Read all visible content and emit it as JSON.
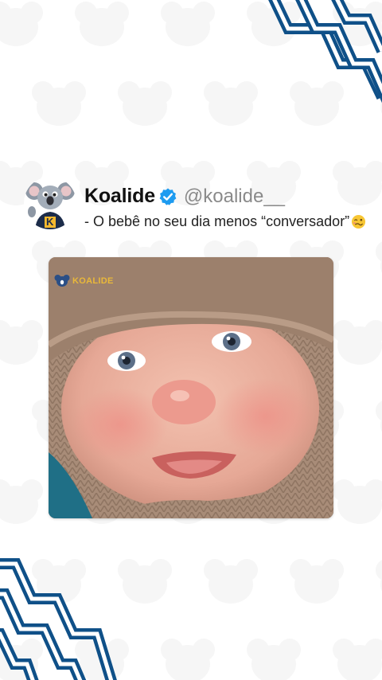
{
  "colors": {
    "accent_blue": "#0f5088",
    "verified_blue": "#1d9bf0",
    "name_text": "#111111",
    "handle_text": "#8a8a8a",
    "caption_text": "#222222",
    "watermark_gold": "#e9b83a"
  },
  "post": {
    "display_name": "Koalide",
    "handle": "@koalide__",
    "caption": "- O bebê no seu dia menos “conversador”",
    "caption_emoji_icon": "woozy-face-icon",
    "verified_icon": "verified-badge-icon"
  },
  "avatar": {
    "icon": "koala-mascot-icon",
    "badge_letter": "K"
  },
  "media": {
    "subject": "baby-photo",
    "watermark_text": "KOALIDE",
    "watermark_icon": "koala-logo-icon"
  },
  "decorations": {
    "top_right": "zigzag-stripes",
    "bottom_left": "zigzag-stripes",
    "background_pattern": "koala-face-pattern"
  }
}
